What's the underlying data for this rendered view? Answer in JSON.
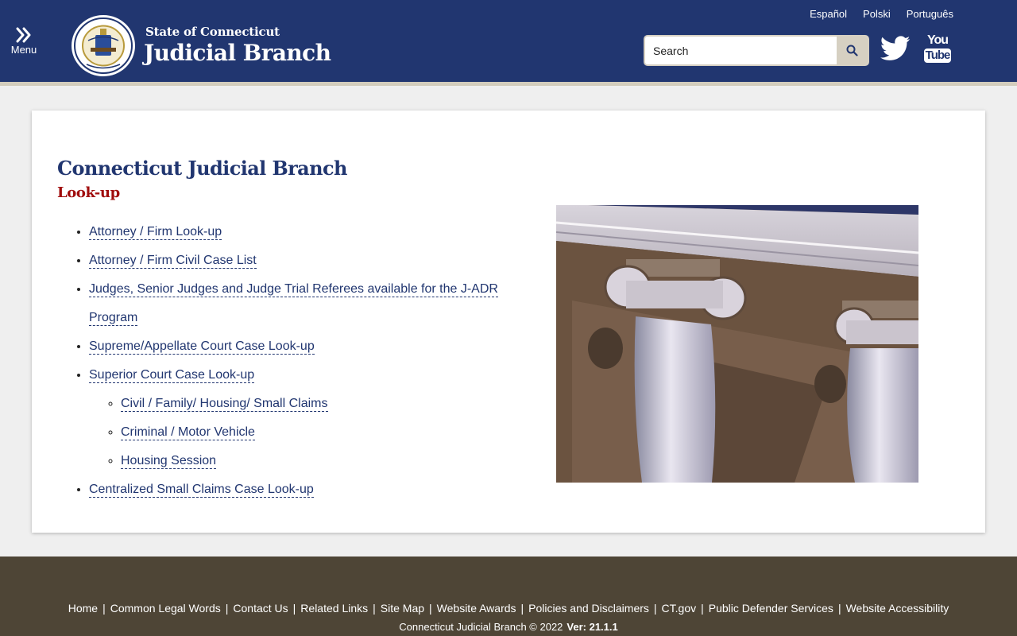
{
  "header": {
    "menu_label": "Menu",
    "brand_sub": "State of Connecticut",
    "brand_main": "Judicial Branch",
    "seal_icon": "state-seal-icon",
    "languages": [
      "Español",
      "Polski",
      "Português"
    ],
    "search": {
      "placeholder": "Search",
      "button_icon": "search-icon"
    },
    "social": [
      "twitter-icon",
      "youtube-icon"
    ],
    "youtube_text": {
      "top": "You",
      "bottom": "Tube"
    },
    "colors": {
      "background": "#213670",
      "accent": "#d6d0c2"
    }
  },
  "main": {
    "title": "Connecticut Judicial Branch",
    "subtitle": "Look-up",
    "links": [
      {
        "label": "Attorney / Firm Look-up"
      },
      {
        "label": "Attorney / Firm Civil Case List"
      },
      {
        "label": "Judges, Senior Judges and Judge Trial Referees available for the J-ADR Program"
      },
      {
        "label": "Supreme/Appellate Court Case Look-up"
      },
      {
        "label": "Superior Court Case Look-up"
      },
      {
        "label": "Centralized Small Claims Case Look-up"
      }
    ],
    "sublinks": [
      {
        "label": "Civil / Family/ Housing/ Small Claims"
      },
      {
        "label": "Criminal / Motor Vehicle"
      },
      {
        "label": "Housing Session"
      }
    ],
    "colors": {
      "title": "#213670",
      "subtitle": "#a00c0c"
    }
  },
  "footer": {
    "links": [
      "Home",
      "Common Legal Words",
      "Contact Us",
      "Related Links",
      "Site Map",
      "Website Awards",
      "Policies and Disclaimers",
      "CT.gov",
      "Public Defender Services",
      "Website Accessibility"
    ],
    "separator": "|",
    "copyright": "Connecticut Judicial Branch © 2022",
    "version": "Ver: 21.1.1",
    "background": "#4e4536"
  }
}
